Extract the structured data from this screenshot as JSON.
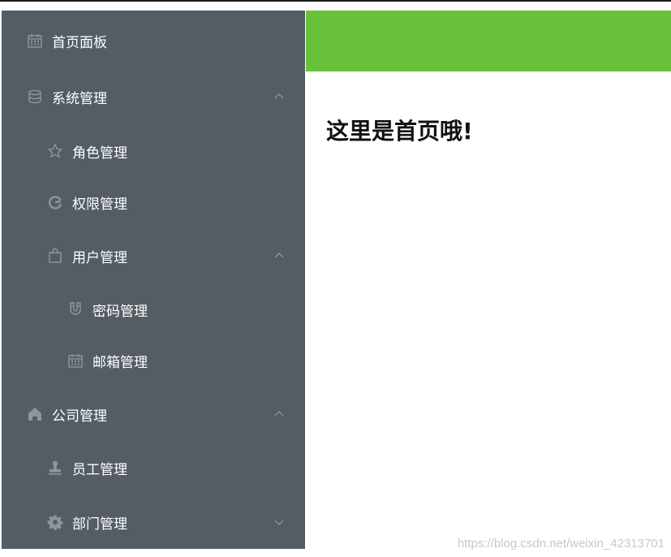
{
  "sidebar": {
    "background": "#545c64",
    "items": [
      {
        "label": "首页面板",
        "icon": "calendar-icon"
      },
      {
        "label": "系统管理",
        "icon": "database-icon",
        "expanded": true
      },
      {
        "label": "角色管理",
        "icon": "star-icon"
      },
      {
        "label": "权限管理",
        "icon": "edit-icon"
      },
      {
        "label": "用户管理",
        "icon": "shopping-bag-icon",
        "expanded": true
      },
      {
        "label": "密码管理",
        "icon": "magnet-icon"
      },
      {
        "label": "邮箱管理",
        "icon": "calendar-icon"
      },
      {
        "label": "公司管理",
        "icon": "home-icon",
        "expanded": true
      },
      {
        "label": "员工管理",
        "icon": "stamp-icon"
      },
      {
        "label": "部门管理",
        "icon": "gear-icon",
        "expanded": false
      }
    ]
  },
  "header": {
    "background": "#67c23a"
  },
  "main": {
    "title": "这里是首页哦!"
  },
  "watermark": "https://blog.csdn.net/weixin_42313701"
}
